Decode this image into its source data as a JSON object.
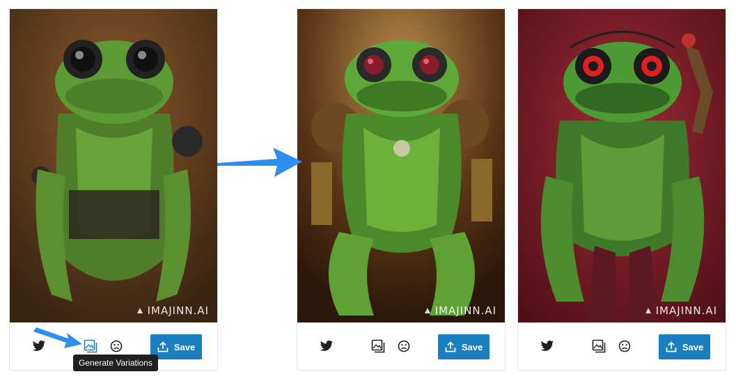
{
  "cards": [
    {
      "watermark": "IMAJINN.AI",
      "background": "#5e3b1e",
      "actions": {
        "twitter": "twitter-icon",
        "variations": "image-variations-icon",
        "feedback": "frown-face-icon",
        "save_label": "Save"
      },
      "tooltip": "Generate Variations"
    },
    {
      "watermark": "IMAJINN.AI",
      "background": "#4a2a12",
      "actions": {
        "twitter": "twitter-icon",
        "variations": "image-variations-icon",
        "feedback": "frown-face-icon",
        "save_label": "Save"
      }
    },
    {
      "watermark": "IMAJINN.AI",
      "background": "#7a1a24",
      "actions": {
        "twitter": "twitter-icon",
        "variations": "image-variations-icon",
        "feedback": "frown-face-icon",
        "save_label": "Save"
      }
    }
  ],
  "colors": {
    "accent": "#1a7fc1",
    "arrow": "#2d8ef0"
  }
}
